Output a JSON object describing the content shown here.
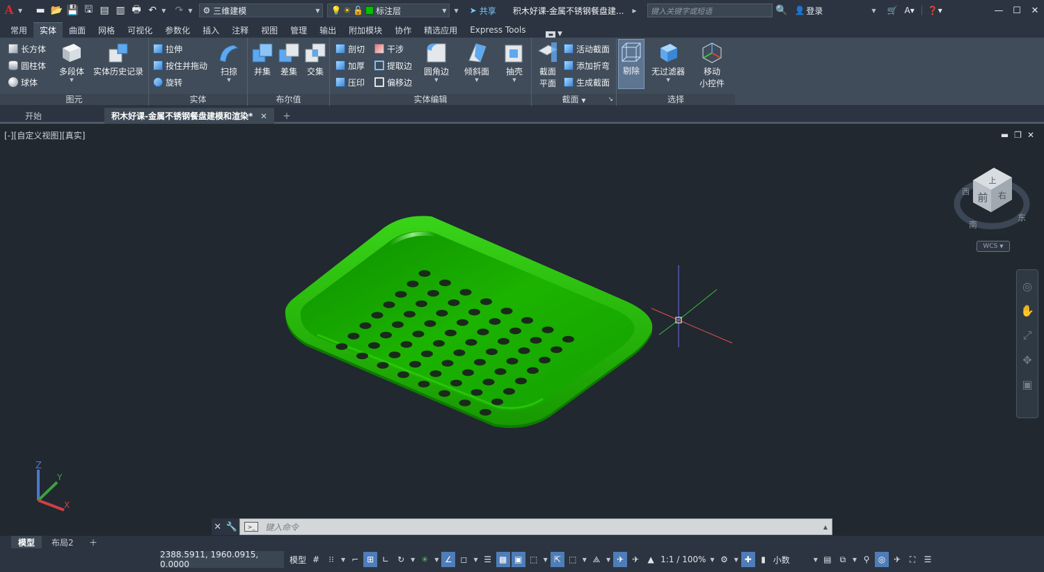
{
  "titlebar": {
    "logo": "A",
    "workspace": "三维建模",
    "layer": "标注层",
    "share": "共享",
    "doc_title": "积木好课-金属不锈钢餐盘建...",
    "search_placeholder": "键入关键字或短语",
    "login": "登录",
    "layer_color": "#00c000"
  },
  "ribbon_tabs": [
    "常用",
    "实体",
    "曲面",
    "网格",
    "可视化",
    "参数化",
    "插入",
    "注释",
    "视图",
    "管理",
    "输出",
    "附加模块",
    "协作",
    "精选应用",
    "Express Tools"
  ],
  "active_tab": "实体",
  "panels": {
    "primitive": {
      "title": "图元",
      "box": "长方体",
      "cylinder": "圆柱体",
      "sphere": "球体",
      "polysolid": "多段体",
      "history": "实体历史记录"
    },
    "solid": {
      "title": "实体",
      "extrude": "拉伸",
      "presspull": "按住并拖动",
      "revolve": "旋转",
      "sweep": "扫掠"
    },
    "boolean": {
      "title": "布尔值",
      "union": "并集",
      "subtract": "差集",
      "intersect": "交集"
    },
    "solidedit": {
      "title": "实体编辑",
      "slice": "剖切",
      "interfere": "干涉",
      "thicken": "加厚",
      "extract": "提取边",
      "imprint": "压印",
      "offset": "偏移边",
      "fillet": "圆角边",
      "chamfer": "倾斜面",
      "shell": "抽壳"
    },
    "section": {
      "title": "截面",
      "plane_1": "截面",
      "plane_2": "平面",
      "live": "活动截面",
      "jog": "添加折弯",
      "generate": "生成截面"
    },
    "selection": {
      "title": "选择",
      "culling": "剔除",
      "nofilter": "无过滤器",
      "gizmo_1": "移动",
      "gizmo_2": "小控件"
    }
  },
  "doc_tabs": {
    "start": "开始",
    "drawing": "积木好课-金属不锈钢餐盘建模和渲染*"
  },
  "viewport": {
    "label": "[-][自定义视图][真实]",
    "viewcube_top": "上",
    "viewcube_front": "前",
    "viewcube_right": "右",
    "compass_south": "南",
    "compass_east": "东",
    "compass_west": "西",
    "wcs": "WCS",
    "tray_color": "#1fb800",
    "ucs_x": "X",
    "ucs_y": "Y",
    "ucs_z": "Z"
  },
  "command": {
    "placeholder": "键入命令"
  },
  "layout_tabs": {
    "model": "模型",
    "layout2": "布局2"
  },
  "status": {
    "coords": "2388.5911, 1960.0915, 0.0000",
    "model": "模型",
    "scale": "1:1 / 100%",
    "units": "小数"
  }
}
